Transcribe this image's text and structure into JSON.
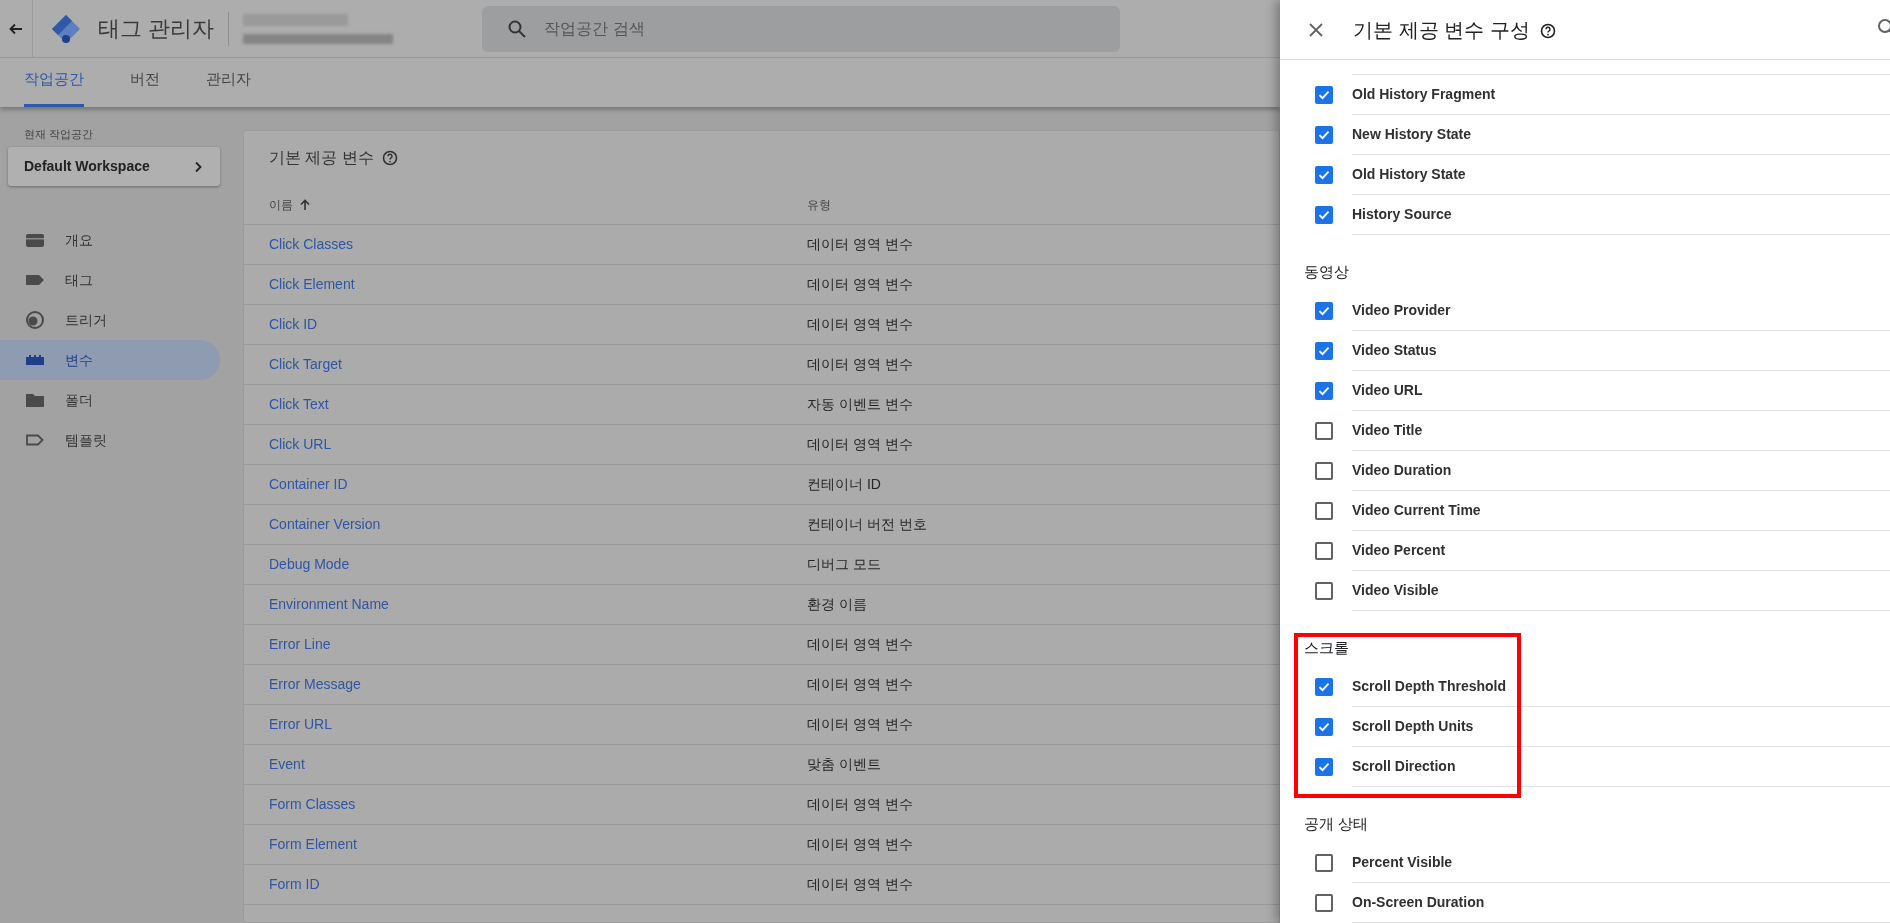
{
  "app": {
    "title": "태그 관리자",
    "search": {
      "placeholder": "작업공간 검색"
    }
  },
  "tabs": [
    {
      "label": "작업공간",
      "selected": true
    },
    {
      "label": "버전",
      "selected": false
    },
    {
      "label": "관리자",
      "selected": false
    }
  ],
  "sidebar": {
    "workspace_label": "현재 작업공간",
    "workspace": "Default Workspace",
    "items": [
      {
        "label": "개요",
        "kind": "overview",
        "selected": false
      },
      {
        "label": "태그",
        "kind": "tag",
        "selected": false
      },
      {
        "label": "트리거",
        "kind": "trigger",
        "selected": false
      },
      {
        "label": "변수",
        "kind": "variable",
        "selected": true
      },
      {
        "label": "폴더",
        "kind": "folder",
        "selected": false
      },
      {
        "label": "템플릿",
        "kind": "template",
        "selected": false
      }
    ]
  },
  "table": {
    "title": "기본 제공 변수",
    "columns": [
      "이름",
      "유형"
    ],
    "rows": [
      [
        "Click Classes",
        "데이터 영역 변수"
      ],
      [
        "Click Element",
        "데이터 영역 변수"
      ],
      [
        "Click ID",
        "데이터 영역 변수"
      ],
      [
        "Click Target",
        "데이터 영역 변수"
      ],
      [
        "Click Text",
        "자동 이벤트 변수"
      ],
      [
        "Click URL",
        "데이터 영역 변수"
      ],
      [
        "Container ID",
        "컨테이너 ID"
      ],
      [
        "Container Version",
        "컨테이너 버전 번호"
      ],
      [
        "Debug Mode",
        "디버그 모드"
      ],
      [
        "Environment Name",
        "환경 이름"
      ],
      [
        "Error Line",
        "데이터 영역 변수"
      ],
      [
        "Error Message",
        "데이터 영역 변수"
      ],
      [
        "Error URL",
        "데이터 영역 변수"
      ],
      [
        "Event",
        "맞춤 이벤트"
      ],
      [
        "Form Classes",
        "데이터 영역 변수"
      ],
      [
        "Form Element",
        "데이터 영역 변수"
      ],
      [
        "Form ID",
        "데이터 영역 변수"
      ]
    ]
  },
  "panel": {
    "title": "기본 제공 변수 구성",
    "sections": [
      {
        "highlighted": false,
        "items": [
          {
            "label": "Old History Fragment",
            "checked": true
          },
          {
            "label": "New History State",
            "checked": true
          },
          {
            "label": "Old History State",
            "checked": true
          },
          {
            "label": "History Source",
            "checked": true
          }
        ]
      },
      {
        "heading": "동영상",
        "highlighted": false,
        "items": [
          {
            "label": "Video Provider",
            "checked": true
          },
          {
            "label": "Video Status",
            "checked": true
          },
          {
            "label": "Video URL",
            "checked": true
          },
          {
            "label": "Video Title",
            "checked": false
          },
          {
            "label": "Video Duration",
            "checked": false
          },
          {
            "label": "Video Current Time",
            "checked": false
          },
          {
            "label": "Video Percent",
            "checked": false
          },
          {
            "label": "Video Visible",
            "checked": false
          }
        ]
      },
      {
        "heading": "스크롤",
        "highlighted": true,
        "items": [
          {
            "label": "Scroll Depth Threshold",
            "checked": true
          },
          {
            "label": "Scroll Depth Units",
            "checked": true
          },
          {
            "label": "Scroll Direction",
            "checked": true
          }
        ]
      },
      {
        "heading": "공개 상태",
        "highlighted": false,
        "items": [
          {
            "label": "Percent Visible",
            "checked": false
          },
          {
            "label": "On-Screen Duration",
            "checked": false
          }
        ]
      }
    ]
  }
}
